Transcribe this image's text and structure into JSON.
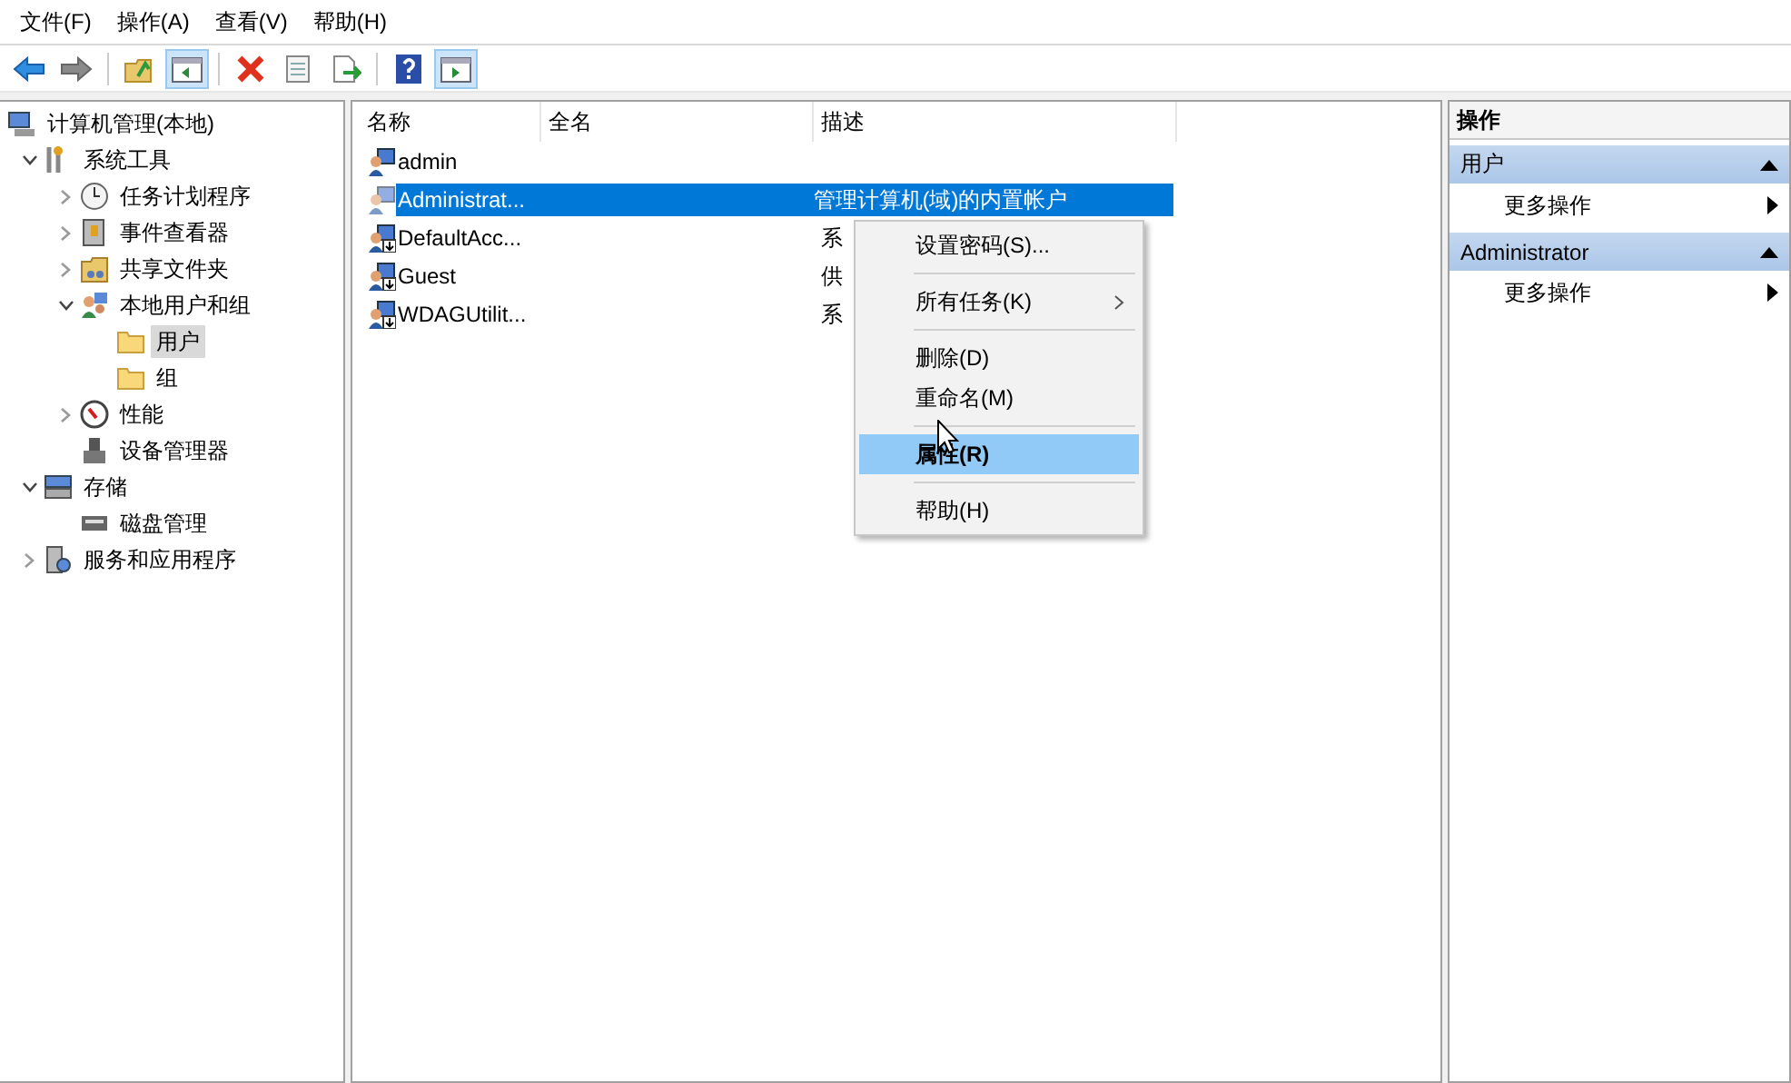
{
  "menu_bar": [
    "文件(F)",
    "操作(A)",
    "查看(V)",
    "帮助(H)"
  ],
  "toolbar": [
    {
      "kind": "back",
      "pressed": false
    },
    {
      "kind": "forward",
      "pressed": false
    },
    {
      "kind": "sep"
    },
    {
      "kind": "up",
      "pressed": false
    },
    {
      "kind": "panel-left",
      "pressed": true
    },
    {
      "kind": "sep"
    },
    {
      "kind": "delete",
      "pressed": false
    },
    {
      "kind": "properties",
      "pressed": false
    },
    {
      "kind": "export",
      "pressed": false
    },
    {
      "kind": "sep"
    },
    {
      "kind": "help",
      "pressed": false
    },
    {
      "kind": "panel-right",
      "pressed": true
    }
  ],
  "tree": [
    {
      "label": "计算机管理(本地)",
      "kind": "computer",
      "selected": false,
      "children": [
        {
          "label": "系统工具",
          "kind": "tools",
          "expanded": true,
          "selected": false,
          "children": [
            {
              "label": "任务计划程序",
              "kind": "clock",
              "expanded": false,
              "selected": false
            },
            {
              "label": "事件查看器",
              "kind": "event",
              "expanded": false,
              "selected": false
            },
            {
              "label": "共享文件夹",
              "kind": "share",
              "expanded": false,
              "selected": false
            },
            {
              "label": "本地用户和组",
              "kind": "users",
              "expanded": true,
              "selected": false,
              "children": [
                {
                  "label": "用户",
                  "kind": "folder",
                  "selected": true
                },
                {
                  "label": "组",
                  "kind": "folder",
                  "selected": false
                }
              ]
            },
            {
              "label": "性能",
              "kind": "perf",
              "expanded": false,
              "selected": false
            },
            {
              "label": "设备管理器",
              "kind": "device",
              "selected": false
            }
          ]
        },
        {
          "label": "存储",
          "kind": "storage",
          "expanded": true,
          "selected": false,
          "children": [
            {
              "label": "磁盘管理",
              "kind": "disk",
              "selected": false
            }
          ]
        },
        {
          "label": "服务和应用程序",
          "kind": "services",
          "expanded": false,
          "selected": false
        }
      ]
    }
  ],
  "table": {
    "columns": [
      "名称",
      "全名",
      "描述"
    ],
    "rows": [
      {
        "name": "admin",
        "kind": "user",
        "selected": false
      },
      {
        "name": "Administrat...",
        "description": "管理计算机(域)的内置帐户",
        "kind": "user",
        "selected": true
      },
      {
        "name": "DefaultAcc...",
        "description": "系",
        "kind": "disabled-user",
        "selected": false
      },
      {
        "name": "Guest",
        "description": "供",
        "kind": "disabled-user",
        "selected": false
      },
      {
        "name": "WDAGUtilit...",
        "description": "系",
        "kind": "disabled-user",
        "selected": false
      }
    ]
  },
  "actions": {
    "title": "操作",
    "sections": [
      {
        "title": "用户",
        "items": [
          "更多操作"
        ]
      },
      {
        "title": "Administrator",
        "items": [
          "更多操作"
        ]
      }
    ]
  },
  "context_menu": [
    {
      "kind": "item",
      "label": "设置密码(S)...",
      "submenu": false,
      "highlighted": false,
      "default": false
    },
    {
      "kind": "separator"
    },
    {
      "kind": "item",
      "label": "所有任务(K)",
      "submenu": true,
      "highlighted": false,
      "default": false
    },
    {
      "kind": "separator"
    },
    {
      "kind": "item",
      "label": "删除(D)",
      "submenu": false,
      "highlighted": false,
      "default": false
    },
    {
      "kind": "item",
      "label": "重命名(M)",
      "submenu": false,
      "highlighted": false,
      "default": false
    },
    {
      "kind": "separator"
    },
    {
      "kind": "item",
      "label": "属性(R)",
      "submenu": false,
      "highlighted": true,
      "default": true
    },
    {
      "kind": "separator"
    },
    {
      "kind": "item",
      "label": "帮助(H)",
      "submenu": false,
      "highlighted": false,
      "default": false
    }
  ]
}
